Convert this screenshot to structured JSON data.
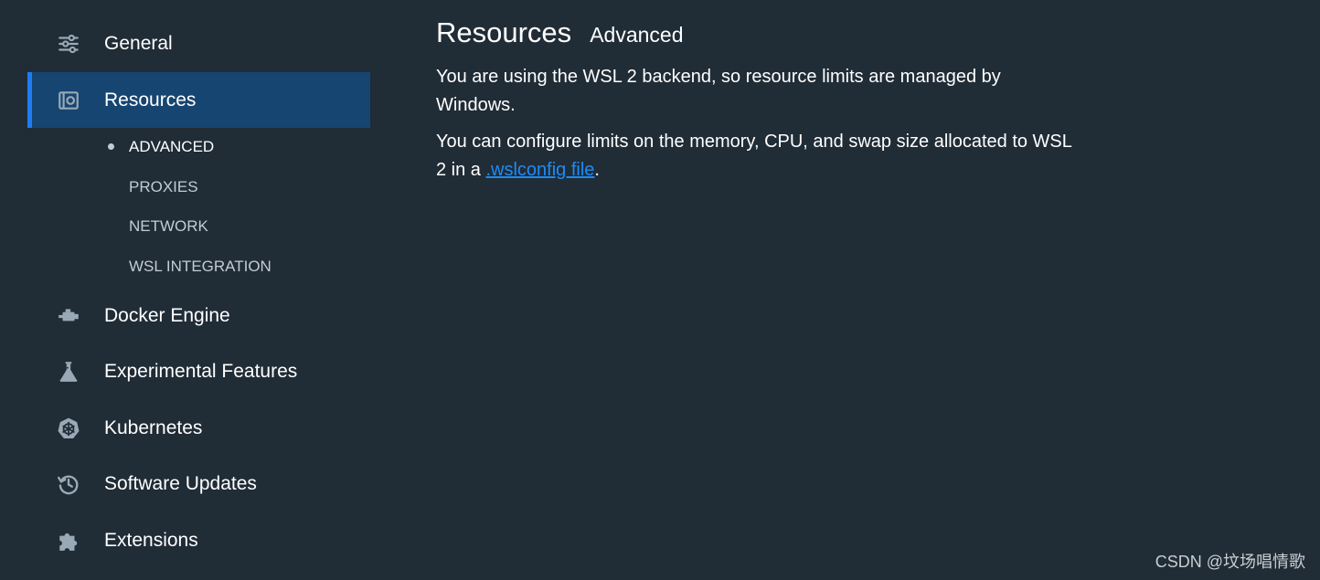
{
  "sidebar": {
    "items": [
      {
        "label": "General",
        "icon": "sliders-icon"
      },
      {
        "label": "Resources",
        "icon": "resources-icon",
        "active": true
      },
      {
        "label": "Docker Engine",
        "icon": "engine-icon"
      },
      {
        "label": "Experimental Features",
        "icon": "flask-icon"
      },
      {
        "label": "Kubernetes",
        "icon": "kubernetes-icon"
      },
      {
        "label": "Software Updates",
        "icon": "history-icon"
      },
      {
        "label": "Extensions",
        "icon": "puzzle-icon"
      }
    ],
    "subitems": [
      {
        "label": "ADVANCED",
        "active": true
      },
      {
        "label": "PROXIES"
      },
      {
        "label": "NETWORK"
      },
      {
        "label": "WSL INTEGRATION"
      }
    ]
  },
  "main": {
    "title": "Resources",
    "subtitle": "Advanced",
    "para1": "You are using the WSL 2 backend, so resource limits are managed by Windows.",
    "para2_before": "You can configure limits on the memory, CPU, and swap size allocated to WSL 2 in a ",
    "link_text": ".wslconfig file",
    "para2_after": "."
  },
  "watermark": "CSDN @坟场唱情歌",
  "colors": {
    "background": "#202c36",
    "active_bg": "#174571",
    "active_accent": "#1f7cf5",
    "link": "#1f8bf5",
    "icon": "#9aa9b6"
  }
}
